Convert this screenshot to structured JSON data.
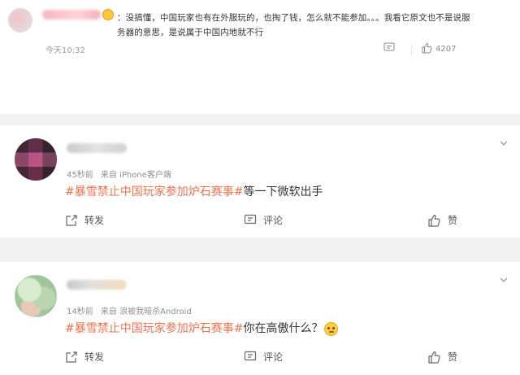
{
  "top_comment": {
    "text": "：没搞懂，中国玩家也有在外服玩的，也掏了钱，怎么就不能参加。。。我看它原文也不是说服务器的意思，是说属于中国内地就不行",
    "time": "今天10:32",
    "like_count": "4207",
    "icons": [
      "comment-icon",
      "like-icon"
    ]
  },
  "comments": [
    {
      "meta_time": "45秒前",
      "meta_source": "来自 iPhone客户端",
      "hashtag": "#暴雪禁止中国玩家参加炉石赛事#",
      "text": "等一下微软出手",
      "has_emoji": false,
      "actions": {
        "repost": "转发",
        "comment": "评论",
        "like": "赞"
      }
    },
    {
      "meta_time": "14秒前",
      "meta_source": "来自 浪被我暗杀Android",
      "hashtag": "#暴雪禁止中国玩家参加炉石赛事#",
      "text": "你在高傲什么？",
      "has_emoji": true,
      "actions": {
        "repost": "转发",
        "comment": "评论",
        "like": "赞"
      }
    }
  ],
  "colors": {
    "hashtag": "#eb7350",
    "separator": "#f2f2f2",
    "meta_text": "#8f8f8f"
  }
}
